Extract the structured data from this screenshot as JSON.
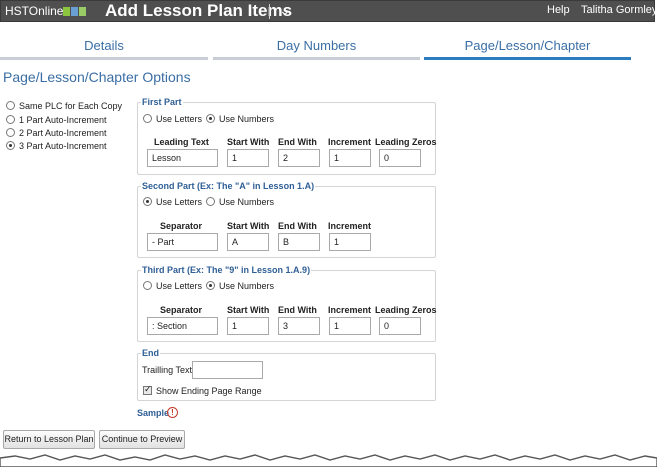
{
  "header": {
    "logo_text": "HSTOnline",
    "logo_colors": [
      "#8cc63f",
      "#6a9fd4",
      "#9c6"
    ],
    "title": "Add Lesson Plan Items",
    "help": "Help",
    "user": "Talitha Gormley"
  },
  "tabs": [
    {
      "label": "Details",
      "active": false
    },
    {
      "label": "Day Numbers",
      "active": false
    },
    {
      "label": "Page/Lesson/Chapter",
      "active": true
    }
  ],
  "section_title": "Page/Lesson/Chapter Options",
  "plc_modes": [
    {
      "label": "Same PLC for Each Copy",
      "selected": false
    },
    {
      "label": "1 Part Auto-Increment",
      "selected": false
    },
    {
      "label": "2 Part Auto-Increment",
      "selected": false
    },
    {
      "label": "3 Part Auto-Increment",
      "selected": true
    }
  ],
  "first_part": {
    "title": "First Part",
    "use_letters": "Use Letters",
    "use_numbers": "Use Numbers",
    "mode": "numbers",
    "headers": {
      "leading_text": "Leading Text",
      "start": "Start With",
      "end": "End With",
      "increment": "Increment",
      "leading_zeros": "Leading Zeros"
    },
    "values": {
      "leading_text": "Lesson",
      "start": "1",
      "end": "2",
      "increment": "1",
      "leading_zeros": "0"
    }
  },
  "second_part": {
    "title": "Second Part (Ex: The \"A\" in Lesson 1.A)",
    "use_letters": "Use Letters",
    "use_numbers": "Use Numbers",
    "mode": "letters",
    "headers": {
      "separator": "Separator",
      "start": "Start With",
      "end": "End With",
      "increment": "Increment"
    },
    "values": {
      "separator": "- Part",
      "start": "A",
      "end": "B",
      "increment": "1"
    }
  },
  "third_part": {
    "title": "Third Part (Ex: The \"9\" in Lesson 1.A.9)",
    "use_letters": "Use Letters",
    "use_numbers": "Use Numbers",
    "mode": "numbers",
    "headers": {
      "separator": "Separator",
      "start": "Start With",
      "end": "End With",
      "increment": "Increment",
      "leading_zeros": "Leading Zeros"
    },
    "values": {
      "separator": ": Section",
      "start": "1",
      "end": "3",
      "increment": "1",
      "leading_zeros": "0"
    }
  },
  "end_part": {
    "title": "End",
    "trailing_label": "Trailling Text",
    "trailing_value": "",
    "show_range_label": "Show Ending Page Range",
    "show_range_checked": true
  },
  "sample": {
    "label": "Sample",
    "icon": "!"
  },
  "buttons": {
    "return": "Return to Lesson Plan",
    "continue": "Continue to Preview"
  }
}
